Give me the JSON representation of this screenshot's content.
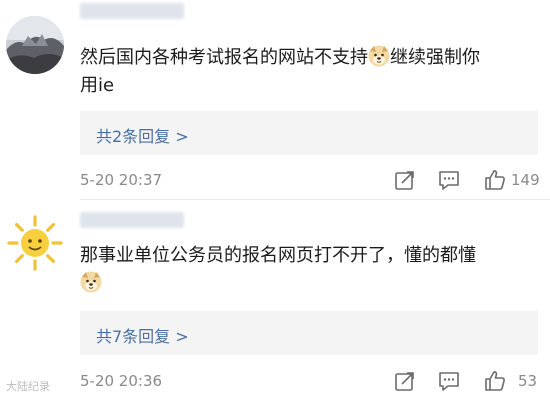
{
  "comments": [
    {
      "text_before_emoji": "然后国内各种考试报名的网站不支持",
      "text_after_emoji": "继续强制你",
      "text_line2": "用ie",
      "replies_label": "共2条回复 >",
      "time": "5-20 20:37",
      "likes": "149",
      "avatar_icon": "landscape-photo-icon"
    },
    {
      "text_line1": "那事业单位公务员的报名网页打不开了，懂的都懂",
      "replies_label": "共7条回复 >",
      "time": "5-20 20:36",
      "likes": "53",
      "avatar_icon": "sun-icon"
    }
  ],
  "emoji": "doge-emoji",
  "watermark": "大陆纪录",
  "colors": {
    "link": "#4c6fa0",
    "meta": "#8a8a8a",
    "reply_bg": "#f4f4f4"
  }
}
